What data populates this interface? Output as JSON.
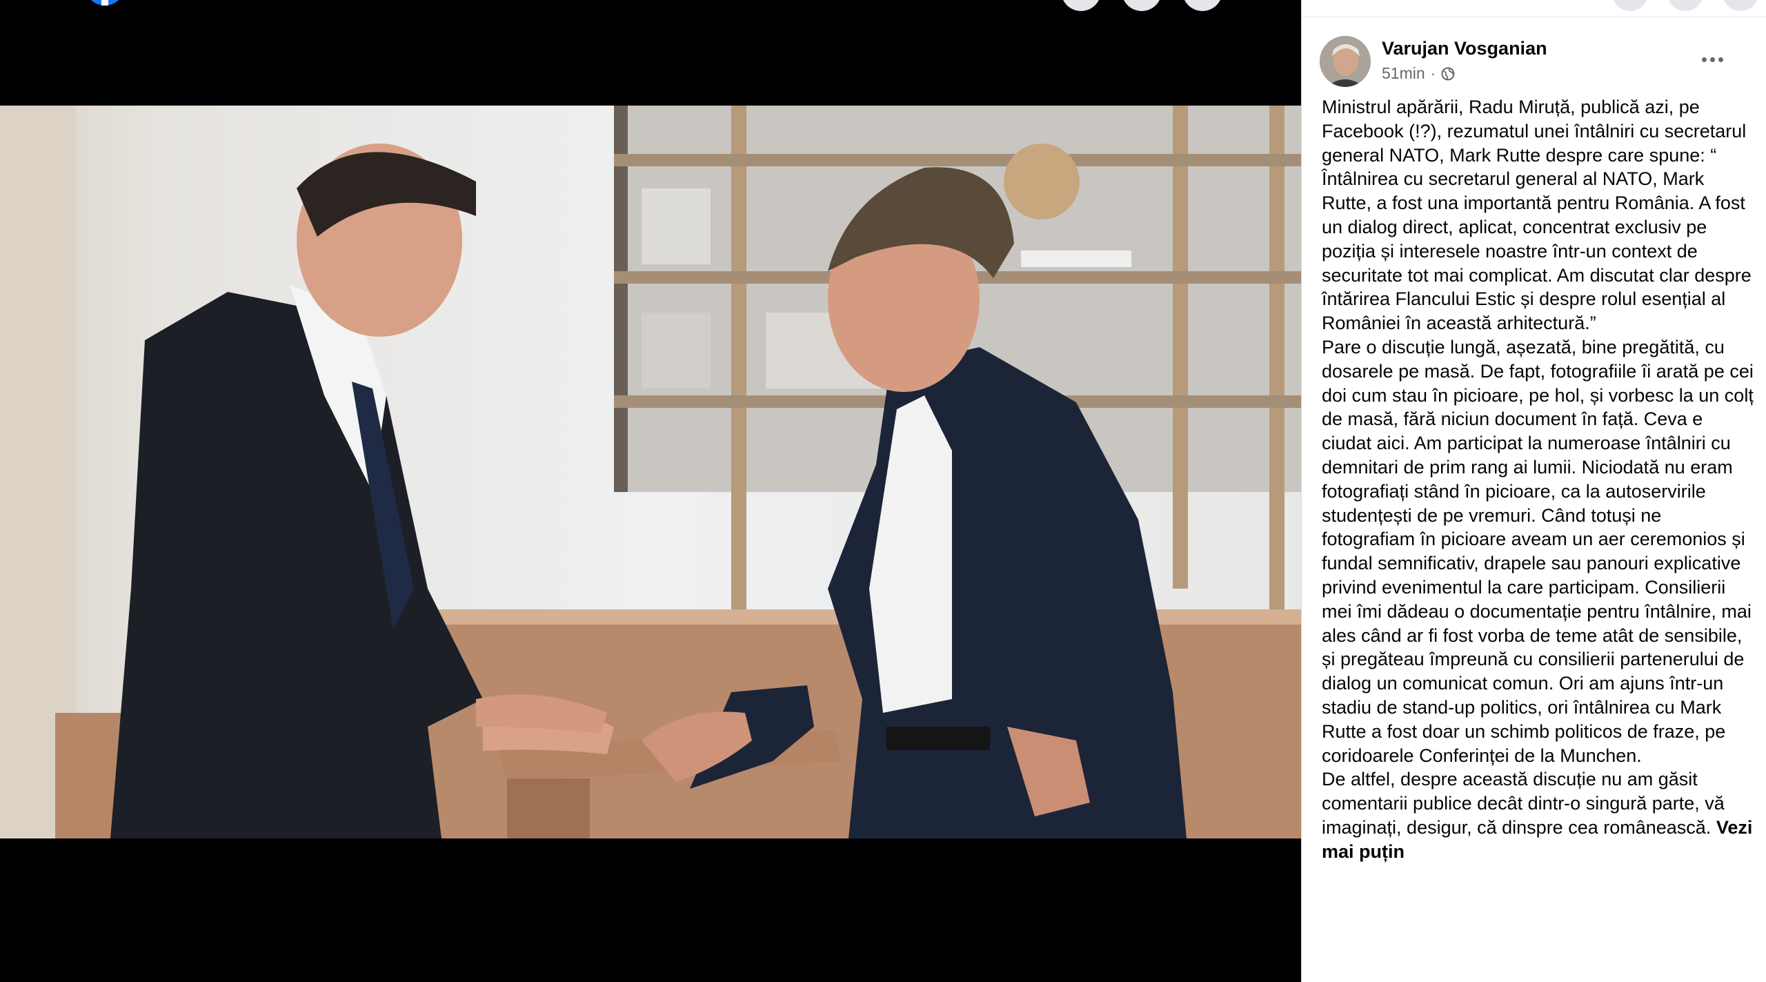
{
  "post": {
    "author": "Varujan Vosganian",
    "time": "51min",
    "meta_separator": "·",
    "privacy_icon": "globe-icon",
    "more_icon": "more-options-icon",
    "paragraphs": [
      "Ministrul apărării, Radu Miruță, publică azi, pe Facebook (!?), rezumatul unei întâlniri cu secretarul general NATO, Mark Rutte despre care spune: “ Întâlnirea cu secretarul general al NATO, Mark Rutte, a fost una importantă pentru România. A fost un dialog direct, aplicat, concentrat exclusiv pe poziția și interesele noastre într-un context de securitate tot mai complicat. Am discutat clar despre întărirea Flancului Estic și despre rolul esențial al României în această arhitectură.”",
      "Pare o discuție lungă, așezată, bine pregătită, cu dosarele pe masă. De fapt, fotografiile îi arată pe cei doi cum stau în picioare, pe hol, și vorbesc la un colț de masă, fără niciun document în față. Ceva e ciudat aici. Am participat la numeroase întâlniri cu demnitari de prim rang ai lumii. Niciodată nu eram fotografiați stând în picioare, ca la autoservirile studențești de pe vremuri. Când totuși ne fotografiam în picioare aveam un aer ceremonios și fundal semnificativ, drapele sau panouri explicative privind evenimentul la care participam. Consilierii mei îmi dădeau o documentație pentru întâlnire, mai ales când ar fi fost vorba de teme atât de sensibile, și pregăteau împreună cu consilierii partenerului de dialog un comunicat comun. Ori am ajuns într-un stadiu de stand-up politics, ori întâlnirea cu Mark Rutte a fost doar un schimb politicos de fraze, pe coridoarele Conferinței de la Munchen.",
      "De altfel, despre această discuție nu am găsit comentarii publice decât dintr-o singură parte, vă imaginați, desigur, că dinspre cea românească."
    ],
    "see_less": "Vezi mai puțin"
  },
  "colors": {
    "facebook_blue": "#1877f2",
    "text_primary": "#050505",
    "text_secondary": "#65676b"
  }
}
